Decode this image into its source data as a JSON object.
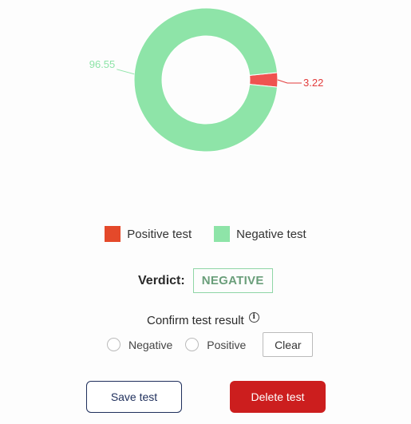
{
  "chart_data": {
    "type": "pie",
    "variant": "donut",
    "slices": [
      {
        "name": "Negative test",
        "value": 96.55,
        "color": "#8ee4a8",
        "label_color": "#8ee4a8"
      },
      {
        "name": "Positive test",
        "value": 3.22,
        "color": "#ef5350",
        "label_color": "#e23b3b"
      }
    ]
  },
  "legend": {
    "items": [
      {
        "label": "Positive test",
        "color": "#e4492a"
      },
      {
        "label": "Negative test",
        "color": "#8ee4a8"
      }
    ]
  },
  "verdict": {
    "label": "Verdict:",
    "value": "NEGATIVE"
  },
  "confirm": {
    "title": "Confirm test result",
    "info_icon": "info-icon",
    "options": [
      "Negative",
      "Positive"
    ],
    "selected": null,
    "clear_label": "Clear"
  },
  "actions": {
    "save_label": "Save test",
    "delete_label": "Delete test"
  }
}
